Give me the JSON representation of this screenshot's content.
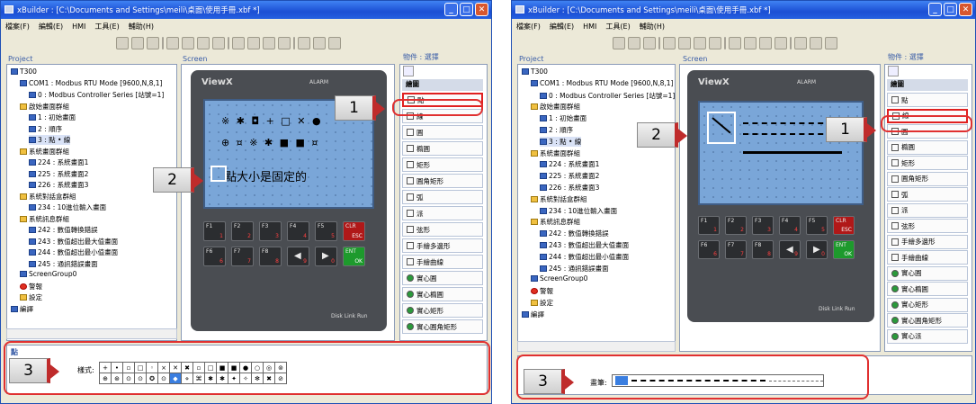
{
  "title": "xBuilder : [C:\\Documents and Settings\\meili\\桌面\\使用手冊.xbf *]",
  "menu": [
    "檔案(F)",
    "編輯(E)",
    "HMI",
    "工具(E)",
    "輔助(H)"
  ],
  "project_label": "Project",
  "screen_label": "Screen",
  "palette_label": "物件 : 選擇",
  "tree": [
    {
      "t": "T300",
      "lvl": 0
    },
    {
      "t": "COM1 : Modbus RTU Mode [9600,N,8,1]",
      "lvl": 1
    },
    {
      "t": "0 : Modbus Controller Series [站號=1]",
      "lvl": 2
    },
    {
      "t": "啟始畫面群組",
      "lvl": 1
    },
    {
      "t": "1 : 初始畫面",
      "lvl": 2
    },
    {
      "t": "2 : 順序",
      "lvl": 2
    },
    {
      "t": "3 : 點 • 線",
      "lvl": 2
    },
    {
      "t": "系統畫面群組",
      "lvl": 1
    },
    {
      "t": "224 : 系統畫面1",
      "lvl": 2
    },
    {
      "t": "225 : 系統畫面2",
      "lvl": 2
    },
    {
      "t": "226 : 系統畫面3",
      "lvl": 2
    },
    {
      "t": "系統對話盒群組",
      "lvl": 1
    },
    {
      "t": "234 : 10進位輸入畫面",
      "lvl": 2
    },
    {
      "t": "系統訊息群組",
      "lvl": 1
    },
    {
      "t": "242 : 數值轉換錯誤",
      "lvl": 2
    },
    {
      "t": "243 : 數值超出最大值畫面",
      "lvl": 2
    },
    {
      "t": "244 : 數值超出最小值畫面",
      "lvl": 2
    },
    {
      "t": "245 : 通訊錯誤畫面",
      "lvl": 2
    },
    {
      "t": "ScreenGroup0",
      "lvl": 1
    },
    {
      "t": "警報",
      "lvl": 1
    },
    {
      "t": "設定",
      "lvl": 1
    },
    {
      "t": "編譯",
      "lvl": 0
    }
  ],
  "device": {
    "brand": "ViewX",
    "alarm": "ALARM",
    "status": [
      "Disk",
      "Link",
      "Run"
    ],
    "fkeys": [
      "F1",
      "F2",
      "F3",
      "F4",
      "F5",
      "F6",
      "F7",
      "F8"
    ],
    "nums": [
      "1",
      "2",
      "3",
      "4",
      "5",
      "6",
      "7",
      "8",
      "9",
      "0"
    ],
    "clr": "CLR",
    "esc": "ESC",
    "ent": "ENT",
    "ok": "OK",
    "pm": "+/-"
  },
  "lcd1": {
    "row1": "※ ✱ ◘ + □ ✕ ●",
    "row2": "⊕ ¤ ※ ✱ ■ ■ ¤",
    "caption": "點大小是固定的"
  },
  "palette_head": "繪圖",
  "palette1": [
    "點",
    "線",
    "圓",
    "橢圓",
    "矩形",
    "圓角矩形",
    "弧",
    "派",
    "弦形",
    "手繪多邊形",
    "手繪曲線",
    "實心圓",
    "實心橢圓",
    "實心矩形",
    "實心圓角矩形"
  ],
  "palette2": [
    "點",
    "線",
    "圓",
    "橢圓",
    "矩形",
    "圓角矩形",
    "弧",
    "派",
    "弦形",
    "手繪多邊形",
    "手繪曲線",
    "實心圓",
    "實心橢圓",
    "實心矩形",
    "實心圓角矩形",
    "實心派"
  ],
  "bottom1": {
    "title": "點",
    "label": "樣式:",
    "row1": [
      "+",
      "•",
      "▫",
      "□",
      "◦",
      "×",
      "✕",
      "✖",
      "▫",
      "□",
      "■",
      "■",
      "●",
      "○",
      "◎",
      "⊚"
    ],
    "row2": [
      "⊕",
      "⊛",
      "⊙",
      "⊙",
      "✪",
      "⊙",
      "◆",
      "⋄",
      "⌘",
      "✱",
      "✱",
      "✦",
      "✧",
      "✻",
      "✖",
      "⊘"
    ],
    "selected": 6
  },
  "bottom2": {
    "label": "畫筆:"
  },
  "callouts": [
    "1",
    "2",
    "3"
  ],
  "colors": {
    "title": "#1b4fd4",
    "lcd": "#7aa6d8",
    "callout_accent": "#bf2b2b",
    "highlight": "#e02020"
  }
}
